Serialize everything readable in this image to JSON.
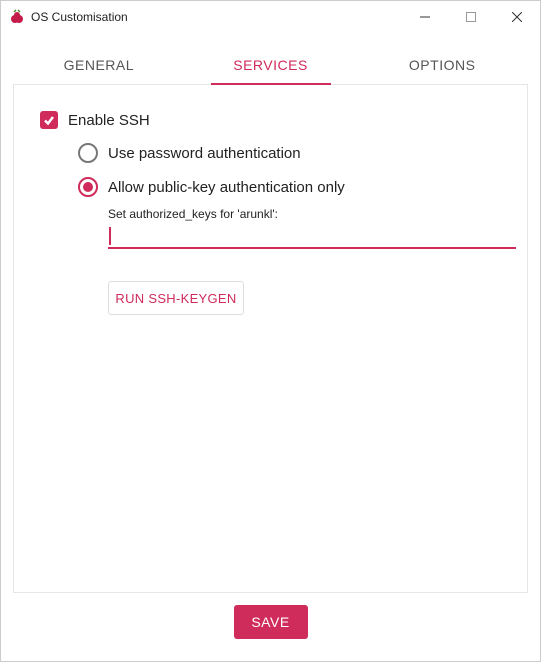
{
  "window": {
    "title": "OS Customisation"
  },
  "tabs": {
    "general": "GENERAL",
    "services": "SERVICES",
    "options": "OPTIONS",
    "active": "services"
  },
  "ssh": {
    "enable_label": "Enable SSH",
    "enabled": true,
    "radio_password": "Use password authentication",
    "radio_pubkey": "Allow public-key authentication only",
    "selected": "pubkey",
    "authkeys_label": "Set authorized_keys for 'arunkl':",
    "authkeys_value": "",
    "keygen_button": "RUN SSH-KEYGEN"
  },
  "footer": {
    "save": "SAVE"
  },
  "colors": {
    "accent": "#cf2b5b"
  }
}
